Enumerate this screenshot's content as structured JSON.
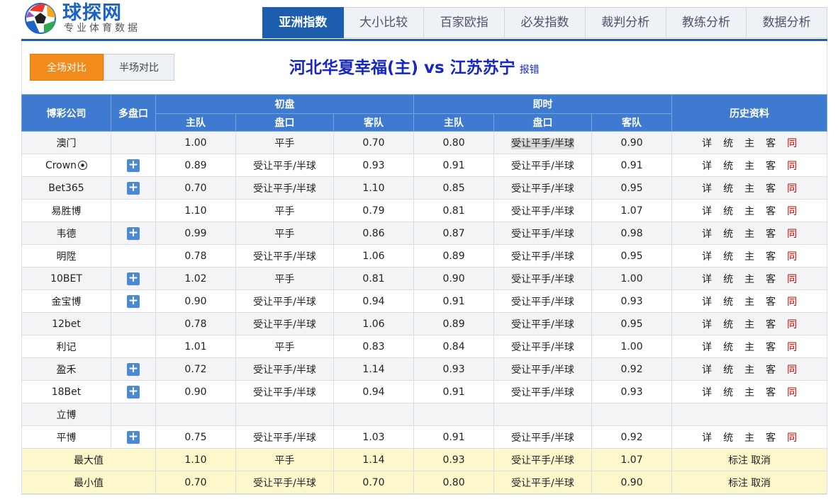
{
  "logo": {
    "name": "球探网",
    "subtitle": "专业体育数据"
  },
  "nav": [
    "亚洲指数",
    "大小比较",
    "百家欧指",
    "必发指数",
    "裁判分析",
    "教练分析",
    "数据分析"
  ],
  "compare": {
    "full": "全场对比",
    "half": "半场对比"
  },
  "match": {
    "home": "河北华夏幸福(主)",
    "vs": "vs",
    "away": "江苏苏宁",
    "report": "报错"
  },
  "headers": {
    "company": "博彩公司",
    "multi": "多盘口",
    "initial": "初盘",
    "live": "即时",
    "history": "历史资料",
    "home": "主队",
    "line": "盘口",
    "away": "客队"
  },
  "plus_symbol": "+",
  "history_links": [
    "详",
    "统",
    "主",
    "客",
    "同"
  ],
  "rows": [
    {
      "company": "澳门",
      "plus": false,
      "ih": "1.00",
      "il": "平手",
      "ia": "0.70",
      "lh": "0.80",
      "ll": "受让平手/半球",
      "la": "0.90",
      "hl": true
    },
    {
      "company": "Crown",
      "crown": true,
      "plus": true,
      "ih": "0.89",
      "il": "受让平手/半球",
      "ia": "0.93",
      "lh": "0.91",
      "ll": "受让平手/半球",
      "la": "0.91"
    },
    {
      "company": "Bet365",
      "plus": true,
      "ih": "0.70",
      "il": "受让平手/半球",
      "ia": "1.10",
      "lh": "0.85",
      "ll": "受让平手/半球",
      "la": "0.95"
    },
    {
      "company": "易胜博",
      "plus": false,
      "ih": "1.10",
      "il": "平手",
      "ia": "0.79",
      "lh": "0.81",
      "ll": "受让平手/半球",
      "la": "1.07"
    },
    {
      "company": "韦德",
      "plus": true,
      "ih": "0.99",
      "il": "平手",
      "ia": "0.86",
      "lh": "0.87",
      "ll": "受让平手/半球",
      "la": "0.98"
    },
    {
      "company": "明陞",
      "plus": false,
      "ih": "0.78",
      "il": "受让平手/半球",
      "ia": "1.06",
      "lh": "0.89",
      "ll": "受让平手/半球",
      "la": "0.95"
    },
    {
      "company": "10BET",
      "plus": true,
      "ih": "1.02",
      "il": "平手",
      "ia": "0.81",
      "lh": "0.90",
      "ll": "受让平手/半球",
      "la": "1.00"
    },
    {
      "company": "金宝博",
      "plus": true,
      "ih": "0.90",
      "il": "受让平手/半球",
      "ia": "0.94",
      "lh": "0.91",
      "ll": "受让平手/半球",
      "la": "0.93"
    },
    {
      "company": "12bet",
      "plus": false,
      "ih": "0.78",
      "il": "受让平手/半球",
      "ia": "1.06",
      "lh": "0.89",
      "ll": "受让平手/半球",
      "la": "0.95"
    },
    {
      "company": "利记",
      "plus": false,
      "ih": "1.01",
      "il": "平手",
      "ia": "0.83",
      "lh": "0.84",
      "ll": "受让平手/半球",
      "la": "1.00"
    },
    {
      "company": "盈禾",
      "plus": true,
      "ih": "0.72",
      "il": "受让平手/半球",
      "ia": "1.14",
      "lh": "0.93",
      "ll": "受让平手/半球",
      "la": "0.92"
    },
    {
      "company": "18Bet",
      "plus": true,
      "ih": "0.90",
      "il": "受让平手/半球",
      "ia": "0.94",
      "lh": "0.91",
      "ll": "受让平手/半球",
      "la": "0.93"
    },
    {
      "company": "立博",
      "plus": false,
      "empty": true,
      "ih": "",
      "il": "",
      "ia": "",
      "lh": "",
      "ll": "",
      "la": ""
    },
    {
      "company": "平博",
      "plus": true,
      "ih": "0.75",
      "il": "受让平手/半球",
      "ia": "1.03",
      "lh": "0.91",
      "ll": "受让平手/半球",
      "la": "0.92"
    }
  ],
  "summary": [
    {
      "label": "最大值",
      "ih": "1.10",
      "il": "平手",
      "ia": "1.14",
      "lh": "0.93",
      "ll": "受让平手/半球",
      "la": "1.07"
    },
    {
      "label": "最小值",
      "ih": "0.70",
      "il": "受让平手/半球",
      "ia": "0.70",
      "lh": "0.80",
      "ll": "受让平手/半球",
      "la": "0.90"
    }
  ],
  "summary_actions": {
    "mark": "标注",
    "cancel": "取消"
  }
}
